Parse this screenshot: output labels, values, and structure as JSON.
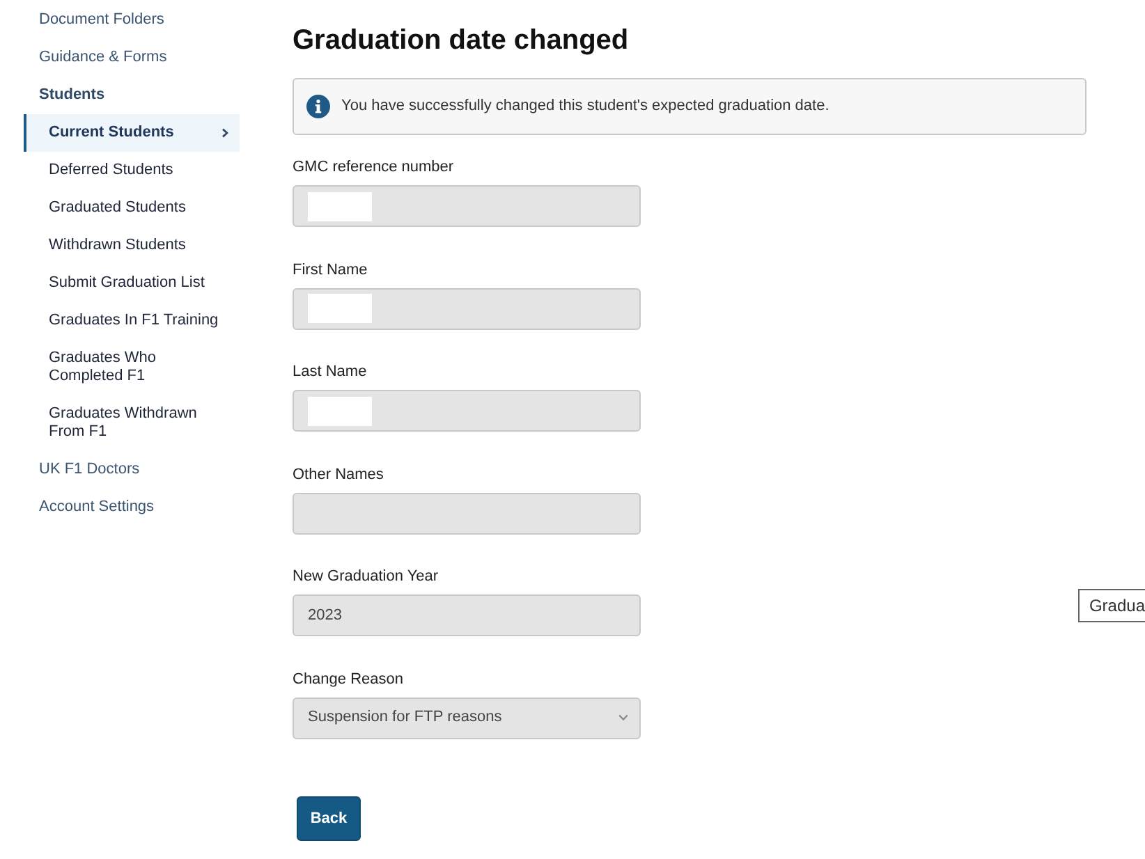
{
  "sidebar": {
    "items": [
      {
        "label": "Document Folders",
        "selected": false,
        "expanded": false
      },
      {
        "label": "Guidance & Forms",
        "selected": false,
        "expanded": false
      },
      {
        "label": "Students",
        "selected": false,
        "expanded": true,
        "children": [
          {
            "label": "Current Students",
            "selected": true
          },
          {
            "label": "Deferred Students",
            "selected": false
          },
          {
            "label": "Graduated Students",
            "selected": false
          },
          {
            "label": "Withdrawn Students",
            "selected": false
          },
          {
            "label": "Submit Graduation List",
            "selected": false
          },
          {
            "label": "Graduates In F1 Training",
            "selected": false
          },
          {
            "label": "Graduates Who Completed F1",
            "selected": false
          },
          {
            "label": "Graduates Withdrawn From F1",
            "selected": false
          }
        ]
      },
      {
        "label": "UK F1 Doctors",
        "selected": false,
        "expanded": false
      },
      {
        "label": "Account Settings",
        "selected": false,
        "expanded": false
      }
    ]
  },
  "page": {
    "title": "Graduation date changed",
    "alert": {
      "kind": "info",
      "message": "You have successfully changed this student's expected graduation date."
    }
  },
  "form": {
    "fields": [
      {
        "label": "GMC reference number",
        "kind": "text",
        "disabled": true,
        "redacted": true
      },
      {
        "label": "First Name",
        "kind": "text",
        "disabled": true,
        "redacted": true
      },
      {
        "label": "Last Name",
        "kind": "text",
        "disabled": true,
        "redacted": true
      },
      {
        "label": "Other Names",
        "kind": "text",
        "disabled": true,
        "redacted": false
      },
      {
        "label": "New Graduation Year",
        "kind": "text",
        "disabled": true,
        "redacted": false,
        "value": "2023"
      },
      {
        "label": "Change Reason",
        "kind": "select",
        "disabled": true,
        "value": "Suspension for FTP reasons"
      }
    ]
  },
  "buttons": [
    {
      "label": "Back"
    }
  ],
  "tooltip": {
    "text": "Gradua"
  }
}
